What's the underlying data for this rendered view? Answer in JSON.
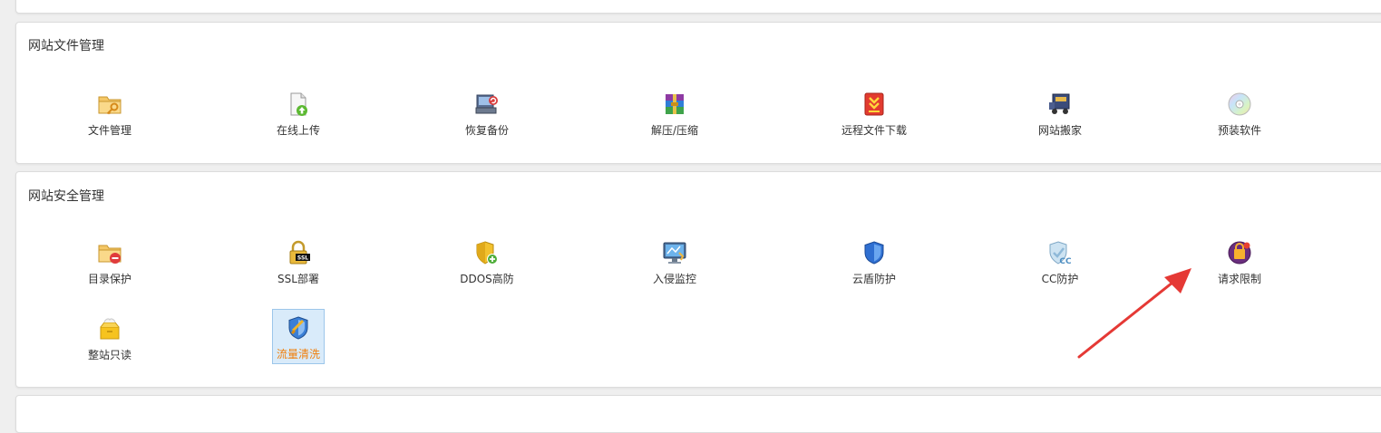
{
  "file_section": {
    "title": "网站文件管理",
    "items": [
      {
        "label": "文件管理",
        "icon": "folder-key-icon"
      },
      {
        "label": "在线上传",
        "icon": "file-upload-icon"
      },
      {
        "label": "恢复备份",
        "icon": "backup-restore-icon"
      },
      {
        "label": "解压/压缩",
        "icon": "archive-icon"
      },
      {
        "label": "远程文件下载",
        "icon": "remote-download-icon"
      },
      {
        "label": "网站搬家",
        "icon": "moving-truck-icon"
      },
      {
        "label": "预装软件",
        "icon": "cd-disc-icon"
      }
    ]
  },
  "security_section": {
    "title": "网站安全管理",
    "items": [
      {
        "label": "目录保护",
        "icon": "folder-lock-icon"
      },
      {
        "label": "SSL部署",
        "icon": "ssl-padlock-icon"
      },
      {
        "label": "DDOS高防",
        "icon": "shield-plus-icon"
      },
      {
        "label": "入侵监控",
        "icon": "monitor-icon"
      },
      {
        "label": "云盾防护",
        "icon": "cloud-shield-icon"
      },
      {
        "label": "CC防护",
        "icon": "cc-shield-icon"
      },
      {
        "label": "请求限制",
        "icon": "request-limit-icon"
      },
      {
        "label": "整站只读",
        "icon": "readonly-box-icon"
      },
      {
        "label": "流量清洗",
        "icon": "traffic-clean-shield-icon",
        "selected": true
      }
    ]
  },
  "annotation": {
    "color": "#e53935",
    "points_to": "请求限制"
  }
}
